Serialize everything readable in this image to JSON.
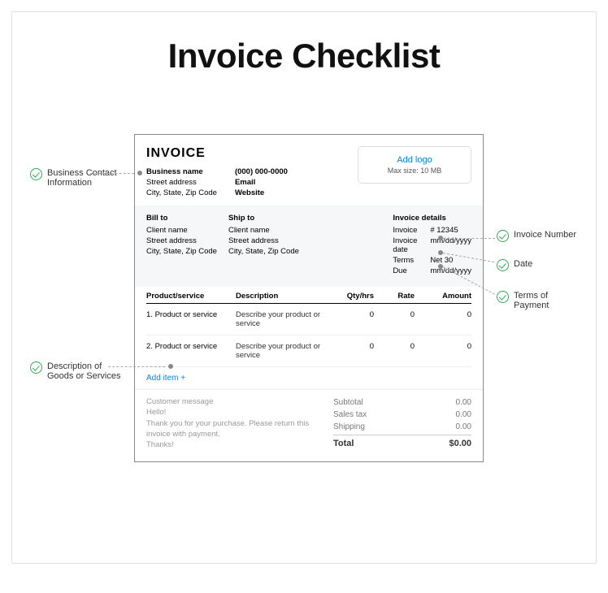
{
  "title": "Invoice Checklist",
  "invoice": {
    "heading": "INVOICE",
    "business": {
      "name": "Business name",
      "street": "Street address",
      "citystate": "City, State, Zip Code",
      "phone": "(000) 000-0000",
      "email": "Email",
      "website": "Website"
    },
    "addlogo": {
      "link": "Add logo",
      "hint": "Max size: 10 MB"
    },
    "billto": {
      "hdr": "Bill to",
      "name": "Client name",
      "street": "Street address",
      "citystate": "City, State, Zip Code"
    },
    "shipto": {
      "hdr": "Ship to",
      "name": "Client name",
      "street": "Street address",
      "citystate": "City, State, Zip Code"
    },
    "details": {
      "hdr": "Invoice details",
      "invoice_k": "Invoice",
      "invoice_v": "# 12345",
      "date_k": "Invoice date",
      "date_v": "mm/dd/yyyy",
      "terms_k": "Terms",
      "terms_v": "Net 30",
      "due_k": "Due",
      "due_v": "mm/dd/yyyy"
    },
    "columns": {
      "c1": "Product/service",
      "c2": "Description",
      "c3": "Qty/hrs",
      "c4": "Rate",
      "c5": "Amount"
    },
    "rows": [
      {
        "num": "1.",
        "name": "Product or service",
        "desc": "Describe your product or service",
        "qty": "0",
        "rate": "0",
        "amt": "0"
      },
      {
        "num": "2.",
        "name": "Product or service",
        "desc": "Describe your product or service",
        "qty": "0",
        "rate": "0",
        "amt": "0"
      }
    ],
    "additem": "Add item +",
    "message": {
      "hdr": "Customer message",
      "l1": "Hello!",
      "l2": "Thank you for your purchase. Please return this invoice with payment.",
      "l3": "Thanks!"
    },
    "totals": {
      "subtotal_k": "Subtotal",
      "subtotal_v": "0.00",
      "tax_k": "Sales tax",
      "tax_v": "0.00",
      "ship_k": "Shipping",
      "ship_v": "0.00",
      "total_k": "Total",
      "total_v": "$0.00"
    }
  },
  "callouts": {
    "contact": "Business Contact Information",
    "goods": "Description of Goods or Services",
    "number": "Invoice Number",
    "date": "Date",
    "terms": "Terms of Payment"
  }
}
